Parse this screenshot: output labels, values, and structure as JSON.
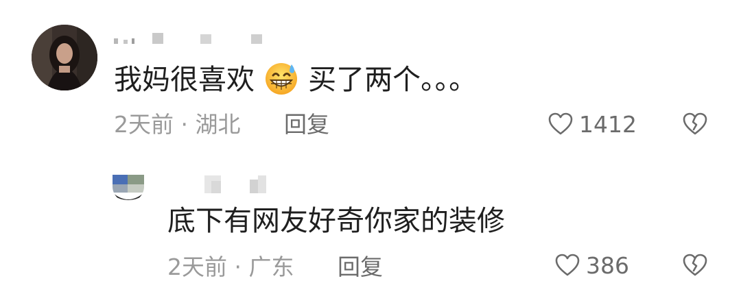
{
  "comments": [
    {
      "text_before_emoji": "我妈很喜欢",
      "emoji": "grinning-face-with-sweat",
      "text_after_emoji": "买了两个。。。",
      "time": "2天前",
      "separator": "·",
      "location": "湖北",
      "reply_label": "回复",
      "likes": "1412"
    },
    {
      "text": "底下有网友好奇你家的装修",
      "time": "2天前",
      "separator": "·",
      "location": "广东",
      "reply_label": "回复",
      "likes": "386"
    }
  ],
  "icons": {
    "like": "heart-outline-icon",
    "dislike": "broken-heart-icon"
  },
  "colors": {
    "text": "#1f1f1f",
    "meta": "#9a9a9a",
    "icon": "#6b6b6b"
  }
}
